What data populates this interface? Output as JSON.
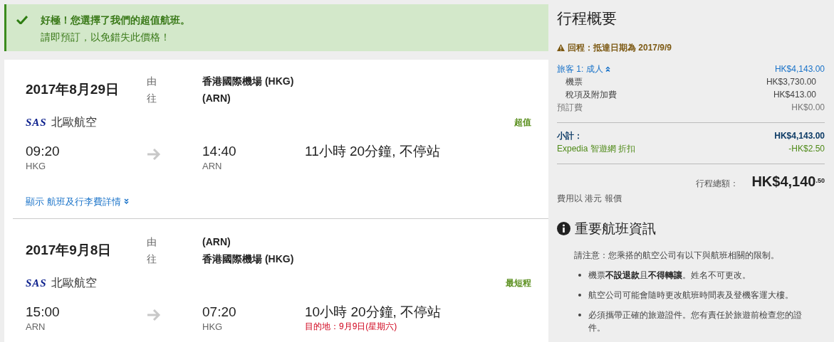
{
  "alert": {
    "title": "好極！您選擇了我們的超值航班。",
    "message": "請即預訂，以免錯失此價格！"
  },
  "flights": [
    {
      "date": "2017年8月29日",
      "from_label": "由",
      "to_label": "往",
      "from_airport": "香港國際機場 (HKG)",
      "to_airport": "(ARN)",
      "airline": "北歐航空",
      "airline_logo": "SAS",
      "tag": "超值",
      "depart_time": "09:20",
      "depart_code": "HKG",
      "arrive_time": "14:40",
      "arrive_code": "ARN",
      "duration": "11小時 20分鐘, 不停站",
      "details_link": "顯示 航班及行李費詳情"
    },
    {
      "date": "2017年9月8日",
      "from_label": "由",
      "to_label": "往",
      "from_airport": "(ARN)",
      "to_airport": "香港國際機場 (HKG)",
      "airline": "北歐航空",
      "airline_logo": "SAS",
      "tag": "最短程",
      "depart_time": "15:00",
      "depart_code": "ARN",
      "arrive_time": "07:20",
      "arrive_code": "HKG",
      "duration": "10小時 20分鐘, 不停站",
      "arrival_note": "目的地：9月9日(星期六)"
    }
  ],
  "summary": {
    "title": "行程概要",
    "warning": "回程：抵達日期為 2017/9/9",
    "traveler": {
      "label": "旅客 1: 成人",
      "amount": "HK$4,143.00",
      "expanded": true
    },
    "lines": [
      {
        "kind": "sub",
        "label": "機票",
        "amount": "HK$3,730.00"
      },
      {
        "kind": "sub",
        "label": "稅項及附加費",
        "amount": "HK$413.00"
      },
      {
        "kind": "fee",
        "label": "預訂費",
        "amount": "HK$0.00"
      }
    ],
    "subtotal": {
      "label": "小計：",
      "amount": "HK$4,143.00"
    },
    "discount": {
      "label": "Expedia 智遊網 折扣",
      "amount": "-HK$2.50"
    },
    "total": {
      "label": "行程總額：",
      "amount": "HK$4,140$^{.50}$"
    },
    "currency_note": "費用以 港元 報價"
  },
  "info": {
    "title": "重要航班資訊",
    "intro": "請注意：您乘搭的航空公司有以下與航班相關的限制。",
    "items": [
      "機票**不設退款**且**不得轉讓**。姓名不可更改。",
      "航空公司可能會隨時更改航班時間表及登機客運大樓。",
      "必須攜帶正確的旅遊證件。您有責任於旅遊前檢查您的證件。"
    ]
  }
}
